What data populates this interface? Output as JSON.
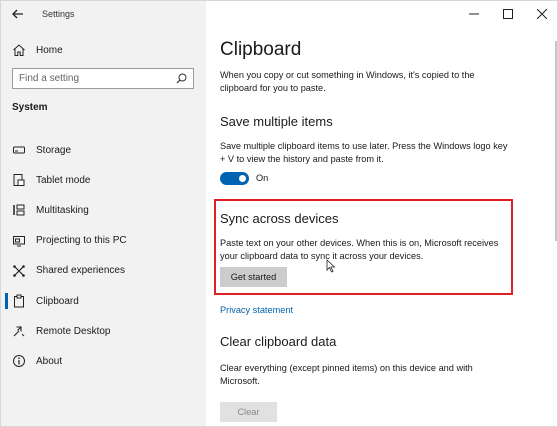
{
  "window": {
    "title": "Settings",
    "controls": [
      "minimize-icon",
      "maximize-icon",
      "close-icon"
    ]
  },
  "sidebar": {
    "home_label": "Home",
    "search_placeholder": "Find a setting",
    "section_label": "System",
    "items": [
      {
        "label": "Storage",
        "icon": "storage-icon"
      },
      {
        "label": "Tablet mode",
        "icon": "tablet-mode-icon"
      },
      {
        "label": "Multitasking",
        "icon": "multitasking-icon"
      },
      {
        "label": "Projecting to this PC",
        "icon": "projecting-icon"
      },
      {
        "label": "Shared experiences",
        "icon": "shared-experiences-icon"
      },
      {
        "label": "Clipboard",
        "icon": "clipboard-icon",
        "active": true
      },
      {
        "label": "Remote Desktop",
        "icon": "remote-desktop-icon"
      },
      {
        "label": "About",
        "icon": "about-icon"
      }
    ]
  },
  "main": {
    "title": "Clipboard",
    "intro": "When you copy or cut something in Windows, it's copied to the clipboard for you to paste.",
    "save_multiple": {
      "heading": "Save multiple items",
      "description": "Save multiple clipboard items to use later. Press the Windows logo key + V to view the history and paste from it.",
      "toggle_state": "On"
    },
    "sync": {
      "heading": "Sync across devices",
      "description": "Paste text on your other devices. When this is on, Microsoft receives your clipboard data to sync it across your devices.",
      "button_label": "Get started"
    },
    "privacy_link": "Privacy statement",
    "clear": {
      "heading": "Clear clipboard data",
      "description": "Clear everything (except pinned items) on this device and with Microsoft.",
      "button_label": "Clear"
    }
  },
  "colors": {
    "accent": "#0063b1",
    "highlight_border": "#e02020",
    "sidebar_bg": "#f2f2f2"
  }
}
